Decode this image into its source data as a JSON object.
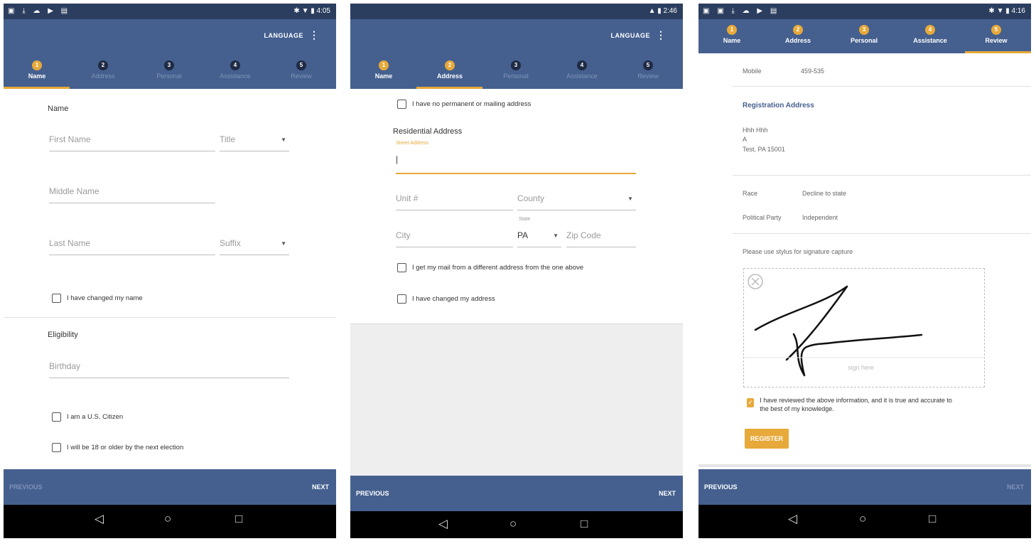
{
  "colors": {
    "primary": "#45608f",
    "accent": "#e7a93a",
    "statusbar": "#2c3e5f"
  },
  "common": {
    "language": "LANGUAGE",
    "previous": "PREVIOUS",
    "next": "NEXT",
    "steps": [
      {
        "num": "1",
        "label": "Name"
      },
      {
        "num": "2",
        "label": "Address"
      },
      {
        "num": "3",
        "label": "Personal"
      },
      {
        "num": "4",
        "label": "Assistance"
      },
      {
        "num": "5",
        "label": "Review"
      }
    ]
  },
  "screen1": {
    "time": "4:05",
    "name_heading": "Name",
    "first_name": "First Name",
    "title": "Title",
    "middle_name": "Middle Name",
    "last_name": "Last Name",
    "suffix": "Suffix",
    "changed_name": "I have changed my name",
    "eligibility_heading": "Eligibility",
    "birthday": "Birthday",
    "citizen": "I am a U.S. Citizen",
    "eighteen": "I will be 18 or older by the next election"
  },
  "screen2": {
    "time": "2:46",
    "no_address": "I have no permanent or mailing address",
    "residential_heading": "Residential Address",
    "street_label": "Street Address",
    "unit": "Unit #",
    "county": "County",
    "state_label": "State",
    "city": "City",
    "state_value": "PA",
    "zip": "Zip Code",
    "different_mail": "I get my mail from a different address from the one above",
    "changed_address": "I have changed my address"
  },
  "screen3": {
    "time": "4:16",
    "mobile_label": "Mobile",
    "mobile_value": "459-535",
    "reg_address_heading": "Registration Address",
    "addr_line1": "Hhh Hhh",
    "addr_line2": "A",
    "addr_line3": "Test, PA 15001",
    "race_label": "Race",
    "race_value": "Decline to state",
    "party_label": "Political Party",
    "party_value": "Independent",
    "stylus_note": "Please use stylus for signature capture",
    "sign_here": "sign here",
    "confirm_text": "I have reviewed the above information, and it is true and accurate to the best of my knowledge.",
    "register": "REGISTER"
  }
}
